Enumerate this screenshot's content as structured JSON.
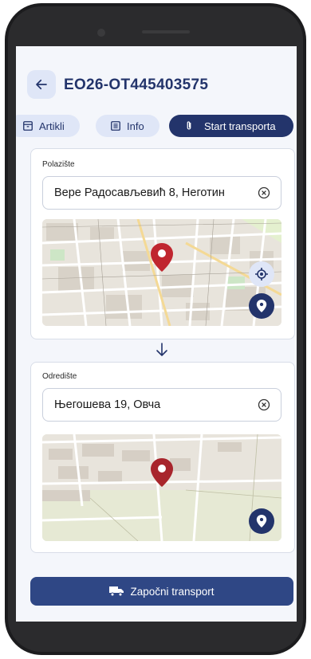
{
  "header": {
    "title": "EO26-OT445403575"
  },
  "tabs": [
    {
      "label": "Artikli",
      "icon": "box-icon"
    },
    {
      "label": "Info",
      "icon": "list-icon"
    },
    {
      "label": "Start transporta",
      "icon": "paperclip-icon"
    }
  ],
  "origin": {
    "label": "Polazište",
    "address": "Вере Радосављевић 8, Неготин"
  },
  "destination": {
    "label": "Odredište",
    "address": "Његошева 19, Овча"
  },
  "action": {
    "label": "Započni transport",
    "icon": "truck-icon"
  },
  "colors": {
    "primary": "#23346b",
    "accent_light": "#dfe6f7",
    "pin": "#c0262f"
  }
}
